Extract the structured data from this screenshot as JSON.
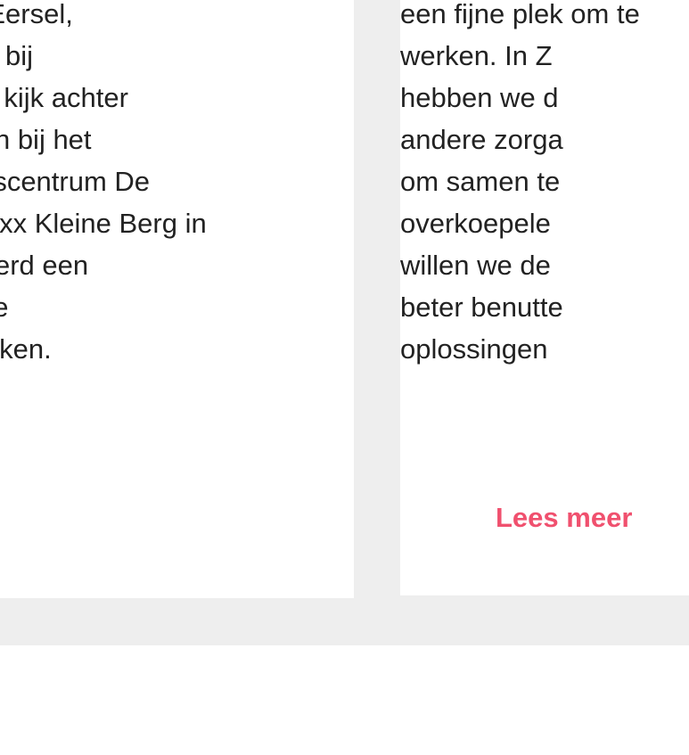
{
  "left_card": {
    "lines": [
      "Gemeente Eersel,",
      "werkbezoek bij",
      "hebben een kijk achter",
      "de schermen bij het",
      "gezondheidscentrum De",
      "Dirk van Kinxx Kleine Berg in",
      "geïnteresseerd een",
      "aantal mooie",
      "wat gesprekken."
    ]
  },
  "right_card": {
    "lines": [
      "een fijne plek om te",
      "werken. In Z",
      "hebben we d",
      "andere zorga",
      "om samen te",
      "overkoepele",
      "willen we de",
      "beter benutte",
      "oplossingen"
    ],
    "link_label": "Lees meer"
  },
  "colors": {
    "background_band": "#eeeeee",
    "card": "#ffffff",
    "text": "#222222",
    "accent": "#f0506e"
  }
}
